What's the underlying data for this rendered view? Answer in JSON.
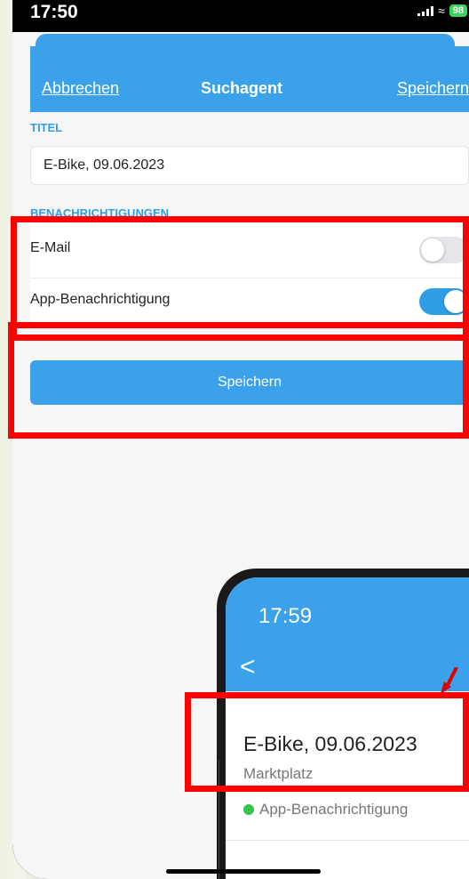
{
  "status_bar": {
    "time": "17:50",
    "battery": "98"
  },
  "nav": {
    "cancel": "Abbrechen",
    "title": "Suchagent",
    "save": "Speichern"
  },
  "title_section": {
    "label": "TITEL",
    "value": "E-Bike, 09.06.2023"
  },
  "notifications": {
    "label": "BENACHRICHTIGUNGEN",
    "email": {
      "label": "E-Mail",
      "enabled": false
    },
    "app": {
      "label": "App-Benachrichtigung",
      "enabled": true
    }
  },
  "save_button": "Speichern",
  "inset": {
    "time": "17:59",
    "back": "<",
    "title": "E-Bike, 09.06.2023",
    "subtitle": "Marktplatz",
    "status": "App-Benachrichtigung"
  },
  "colors": {
    "accent": "#3aa1ea",
    "highlight": "#ff0000",
    "status_dot": "#37c24c"
  }
}
